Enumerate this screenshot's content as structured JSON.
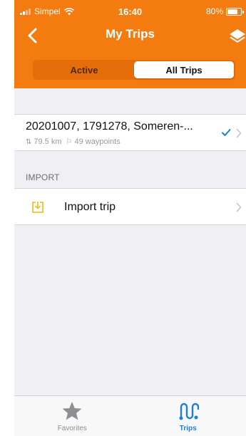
{
  "status_bar": {
    "carrier": "Simpel",
    "time": "16:40",
    "battery_percent": "80%",
    "battery_level": 0.8,
    "wifi_icon": "wifi-icon"
  },
  "nav": {
    "title": "My Trips",
    "back_icon": "chevron-left-icon",
    "layers_icon": "layers-icon"
  },
  "segmented": {
    "items": [
      {
        "label": "Active",
        "selected": false
      },
      {
        "label": "All Trips",
        "selected": true
      }
    ]
  },
  "trips": [
    {
      "name": "20201007, 1791278, Someren-...",
      "distance": "79.5 km",
      "waypoints": "49 waypoints",
      "active": true
    }
  ],
  "import_section": {
    "header": "IMPORT",
    "row_label": "Import trip",
    "icon": "import-icon"
  },
  "tabs": [
    {
      "label": "Favorites",
      "icon": "star-icon",
      "selected": false
    },
    {
      "label": "Trips",
      "icon": "trips-route-icon",
      "selected": true
    }
  ],
  "colors": {
    "brand_orange": "#f47b10",
    "accent_blue": "#1e7fd6",
    "background": "#efeff4",
    "import_icon_yellow": "#f2c230"
  }
}
